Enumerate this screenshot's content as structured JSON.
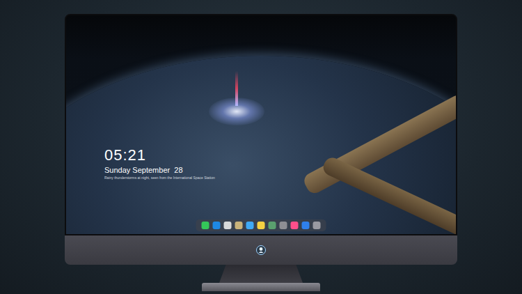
{
  "screen": {
    "clock": {
      "time": "05:21",
      "date": "Sunday September  28",
      "caption": "Rainy thunderstorms at night, seen from the International Space Station"
    }
  },
  "dock": {
    "apps": [
      {
        "color": "#34c759"
      },
      {
        "color": "#1e88e5"
      },
      {
        "color": "#d9d9d9"
      },
      {
        "color": "#c9b27a"
      },
      {
        "color": "#3fa9f5"
      },
      {
        "color": "#f5d142"
      },
      {
        "color": "#5aa06e"
      },
      {
        "color": "#8e8e93"
      },
      {
        "color": "#ff4f8b"
      },
      {
        "color": "#2f80ed"
      },
      {
        "color": "#9a9aa2"
      }
    ]
  }
}
